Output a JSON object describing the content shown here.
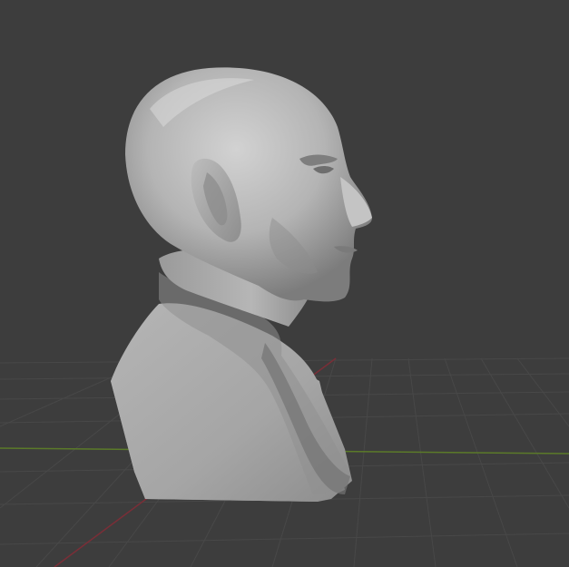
{
  "viewport": {
    "background": "#3d3d3d",
    "grid_line_color": "#484848",
    "x_axis_color": "#7a2e37",
    "y_axis_color": "#5b7a29",
    "object": "bust-sculpt-mesh",
    "object_base_color": "#a3a3a3"
  }
}
